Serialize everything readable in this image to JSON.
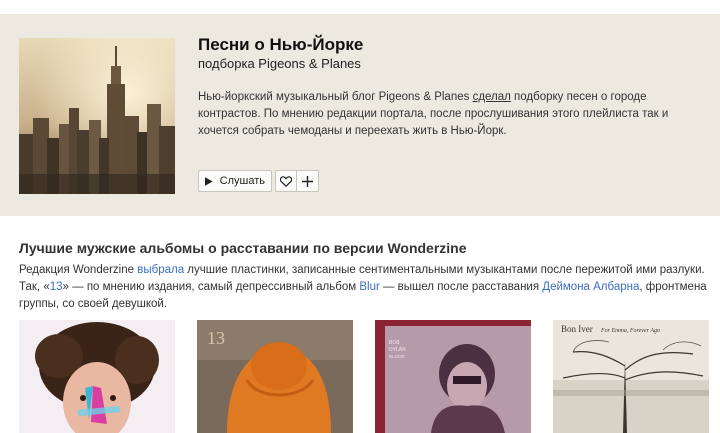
{
  "playlist": {
    "title": "Песни о Нью-Йорке",
    "subtitle": "подборка Pigeons & Planes",
    "description_part1": "Нью-йоркский музыкальный блог Pigeons & Planes ",
    "description_link": "сделал",
    "description_part2": " подборку песен о городе контрастов. По мнению редакции портала, после прослушивания этого плейлиста так и хочется собрать чемоданы и переехать жить в Нью-Йорк.",
    "listen_label": "Слушать",
    "play_icon": "play-icon",
    "like_icon": "heart-icon",
    "add_icon": "plus-icon"
  },
  "section": {
    "title": "Лучшие мужские альбомы о расставании по версии Wonderzine",
    "desc_1": "Редакция Wonderzine ",
    "link_chose": "выбрала",
    "desc_2": " лучшие пластинки, записанные сентиментальными музыкантами после пережитой ими разлуки. Так, «",
    "link_13": "13",
    "desc_3": "» — по мнению издания, самый депрессивный альбом ",
    "link_blur": "Blur",
    "desc_4": " — вышел после расставания ",
    "link_damon": "Деймона Албарна",
    "desc_5": ", фронтмена группы, со своей девушкой."
  },
  "albums": {
    "a3_text_1": "BOB",
    "a3_text_2": "DYLAN",
    "a3_text_3": "BLOOD ON THE TRACKS",
    "a4_text": "Bon Iver",
    "a4_sub": "For Emma, Forever Ago"
  },
  "colors": {
    "panel_bg": "#ece9e1",
    "link": "#3b6ec4"
  }
}
